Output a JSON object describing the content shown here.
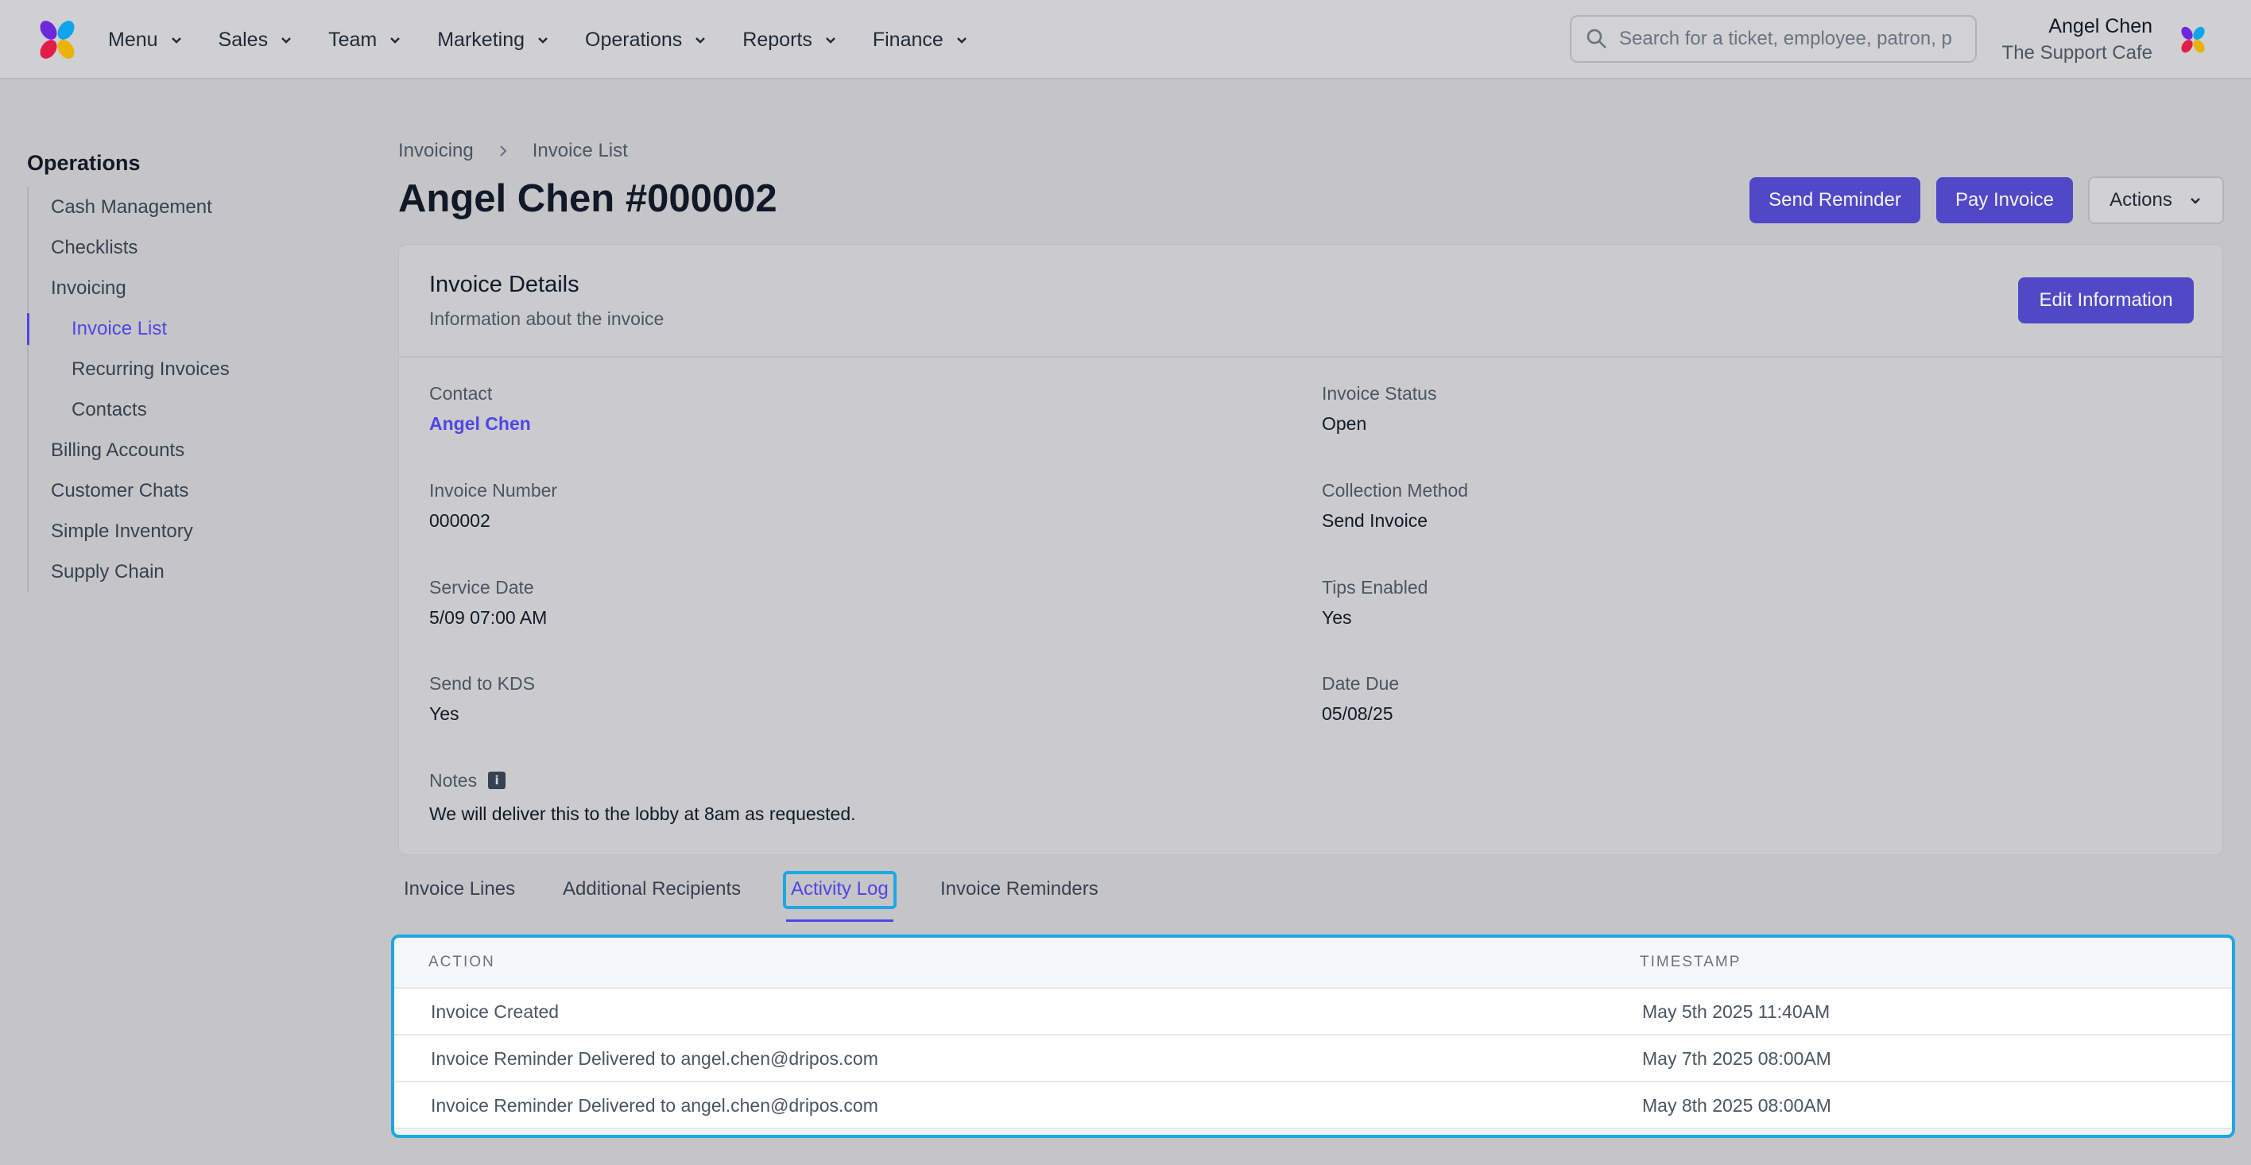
{
  "nav": {
    "items": [
      {
        "label": "Menu"
      },
      {
        "label": "Sales"
      },
      {
        "label": "Team"
      },
      {
        "label": "Marketing"
      },
      {
        "label": "Operations"
      },
      {
        "label": "Reports"
      },
      {
        "label": "Finance"
      }
    ],
    "search_placeholder": "Search for a ticket, employee, patron, p",
    "user_name": "Angel Chen",
    "user_org": "The Support Cafe"
  },
  "sidebar": {
    "title": "Operations",
    "items": [
      {
        "label": "Cash Management"
      },
      {
        "label": "Checklists"
      },
      {
        "label": "Invoicing"
      },
      {
        "label": "Invoice List"
      },
      {
        "label": "Recurring Invoices"
      },
      {
        "label": "Contacts"
      },
      {
        "label": "Billing Accounts"
      },
      {
        "label": "Customer Chats"
      },
      {
        "label": "Simple Inventory"
      },
      {
        "label": "Supply Chain"
      }
    ]
  },
  "breadcrumb": {
    "first": "Invoicing",
    "second": "Invoice List"
  },
  "page_title": "Angel Chen #000002",
  "actions": {
    "send_reminder": "Send Reminder",
    "pay_invoice": "Pay Invoice",
    "actions": "Actions",
    "edit_information": "Edit Information"
  },
  "details": {
    "title": "Invoice Details",
    "subtitle": "Information about the invoice",
    "contact_label": "Contact",
    "contact_value": "Angel Chen",
    "status_label": "Invoice Status",
    "status_value": "Open",
    "number_label": "Invoice Number",
    "number_value": "000002",
    "collection_label": "Collection Method",
    "collection_value": "Send Invoice",
    "service_label": "Service Date",
    "service_value": "5/09 07:00 AM",
    "tips_label": "Tips Enabled",
    "tips_value": "Yes",
    "kds_label": "Send to KDS",
    "kds_value": "Yes",
    "due_label": "Date Due",
    "due_value": "05/08/25",
    "notes_label": "Notes",
    "notes_value": "We will deliver this to the lobby at 8am as requested."
  },
  "tabs": [
    {
      "label": "Invoice Lines"
    },
    {
      "label": "Additional Recipients"
    },
    {
      "label": "Activity Log"
    },
    {
      "label": "Invoice Reminders"
    }
  ],
  "activity": {
    "headers": {
      "action": "ACTION",
      "timestamp": "TIMESTAMP"
    },
    "rows": [
      {
        "action": "Invoice Created",
        "timestamp": "May 5th 2025 11:40AM"
      },
      {
        "action": "Invoice Reminder Delivered to angel.chen@dripos.com",
        "timestamp": "May 7th 2025 08:00AM"
      },
      {
        "action": "Invoice Reminder Delivered to angel.chen@dripos.com",
        "timestamp": "May 8th 2025 08:00AM"
      }
    ]
  },
  "colors": {
    "accent": "#4f46e5",
    "button": "#5048c6",
    "focus": "#1fa6e6"
  }
}
